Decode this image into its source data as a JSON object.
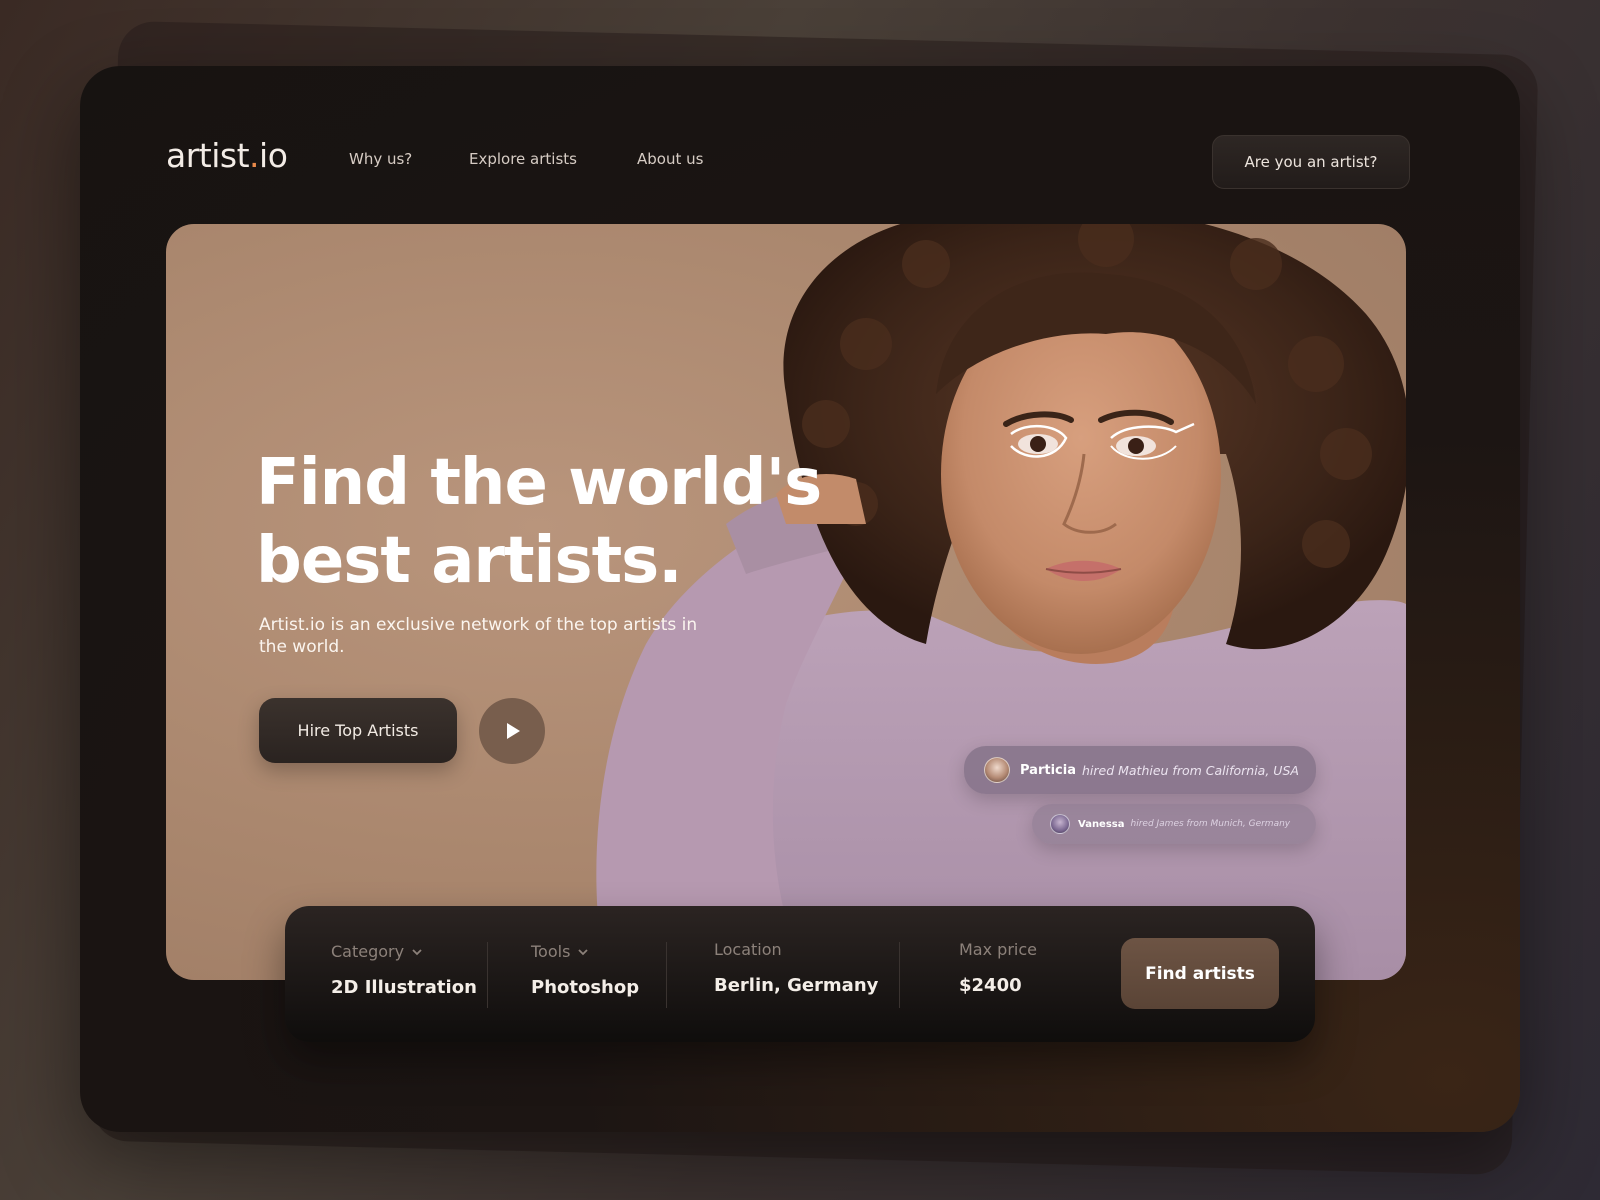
{
  "logo": {
    "text": "artist",
    "suffix_dot": ".",
    "suffix": "io"
  },
  "nav": {
    "why": "Why us?",
    "explore": "Explore artists",
    "about": "About us"
  },
  "header_cta": "Are you an artist?",
  "hero": {
    "headline_line1": "Find the world's",
    "headline_line2": "best artists.",
    "subtext": "Artist.io is an exclusive network of the top artists in the world.",
    "hire_button": "Hire Top Artists",
    "play_icon": "play-icon"
  },
  "notifications": [
    {
      "name": "Particia",
      "message": "hired Mathieu from California, USA"
    },
    {
      "name": "Vanessa",
      "message": "hired James from Munich, Germany"
    }
  ],
  "search": {
    "category": {
      "label": "Category",
      "value": "2D Illustration"
    },
    "tools": {
      "label": "Tools",
      "value": "Photoshop"
    },
    "location": {
      "label": "Location",
      "value": "Berlin, Germany"
    },
    "max_price": {
      "label": "Max price",
      "value": "$2400"
    },
    "button": "Find artists"
  },
  "colors": {
    "accent": "#e98a4a",
    "hero_bg": "#a9866d",
    "sweater": "#b49ab0",
    "button_brown": "#6d5444"
  }
}
